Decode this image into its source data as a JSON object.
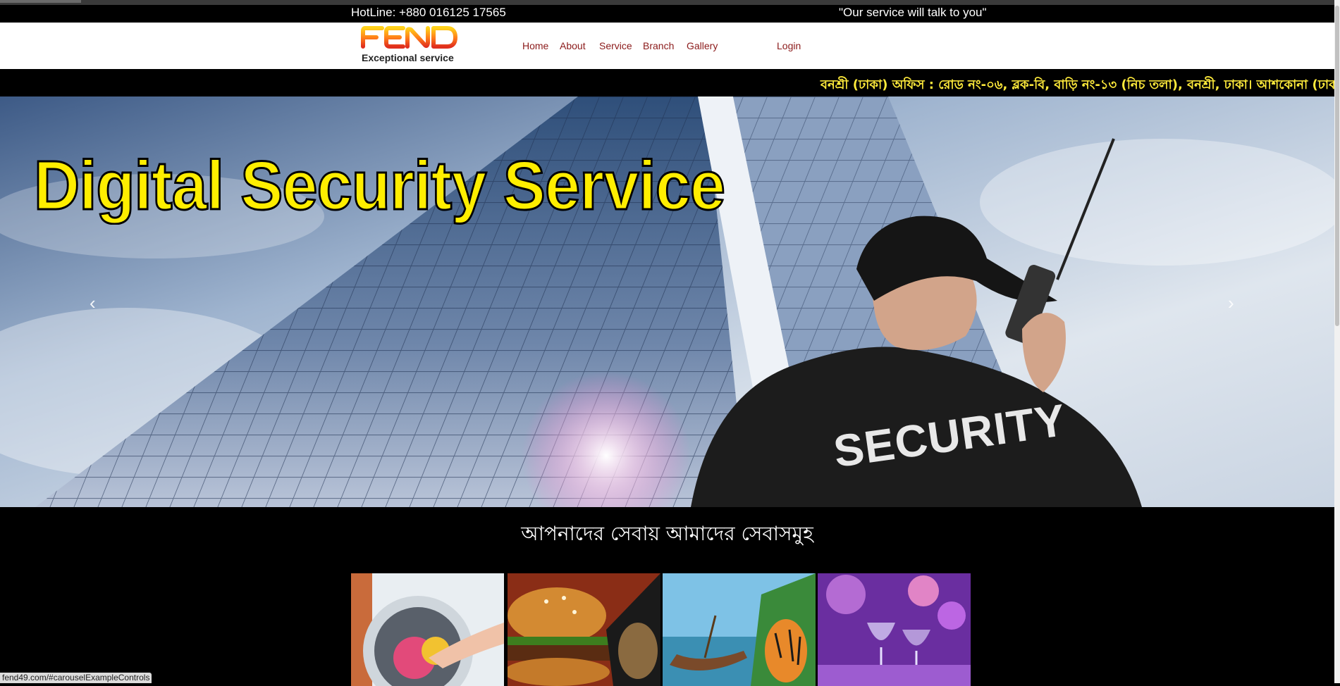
{
  "topbar": {
    "hotline": "HotLine: +880 016125 17565",
    "quote": "\"Our service will talk to you\""
  },
  "logo": {
    "brand": "FEND",
    "tagline": "Exceptional service"
  },
  "nav": {
    "items": [
      "Home",
      "About",
      "Service",
      "Branch",
      "Gallery"
    ],
    "login": "Login"
  },
  "marquee": {
    "text": "বনশ্রী (ঢাকা) অফিস : রোড নং-০৬, ব্লক-বি, বাড়ি নং-১৩ (নিচ তলা), বনশ্রী, ঢাকা। আশকোনা (ঢাকা) অফিস : ব"
  },
  "hero": {
    "title": "Digital Security Service",
    "jacket": "SECURITY",
    "prev_icon": "chevron-left-icon",
    "next_icon": "chevron-right-icon"
  },
  "services": {
    "title": "আপনাদের সেবায় আমাদের সেবাসমুহ",
    "tiles": [
      "laundry-image",
      "food-image",
      "tour-image",
      "event-image"
    ]
  },
  "status_bar": {
    "url": "fend49.com/#carouselExampleControls"
  },
  "colors": {
    "nav_link": "#8b1a1a",
    "marquee_text": "#ffeb3b",
    "hero_title": "#ffee00"
  }
}
